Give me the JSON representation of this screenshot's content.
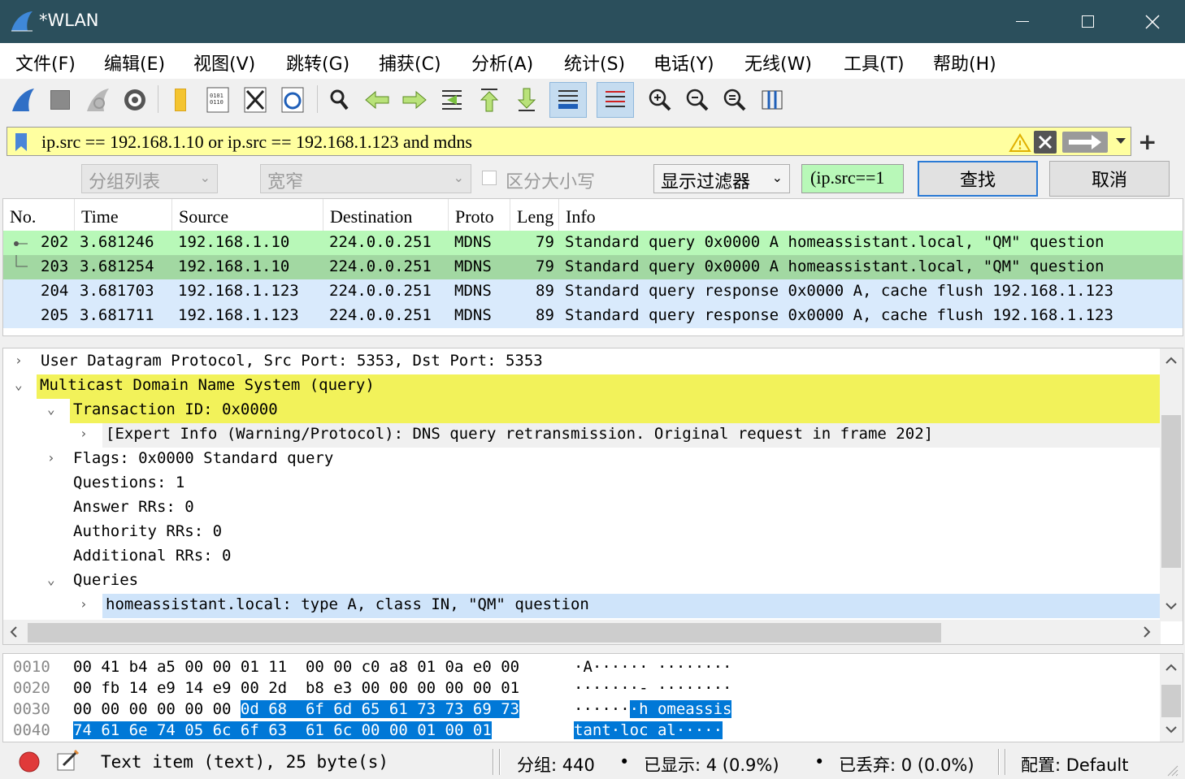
{
  "window": {
    "title": "*WLAN"
  },
  "menu": [
    "文件(F)",
    "编辑(E)",
    "视图(V)",
    "跳转(G)",
    "捕获(C)",
    "分析(A)",
    "统计(S)",
    "电话(Y)",
    "无线(W)",
    "工具(T)",
    "帮助(H)"
  ],
  "toolbar": {
    "icons": [
      "start-capture-icon",
      "stop-capture-icon",
      "restart-capture-icon",
      "capture-options-icon",
      "open-file-icon",
      "save-file-icon",
      "close-file-icon",
      "reload-file-icon",
      "find-packet-icon",
      "go-back-icon",
      "go-forward-icon",
      "go-to-packet-icon",
      "go-first-icon",
      "go-last-icon",
      "autoscroll-icon",
      "colorize-icon",
      "zoom-in-icon",
      "zoom-out-icon",
      "normal-size-icon",
      "resize-columns-icon"
    ]
  },
  "filter": {
    "value": "ip.src == 192.168.1.10 or ip.src == 192.168.1.123 and mdns",
    "warning_color": "#e0b000",
    "bg_color": "#ffffa0"
  },
  "findbar": {
    "scope": "分组列表",
    "charset": "宽窄",
    "case_label": "区分大小写",
    "search_type": "显示过滤器",
    "search_value": "(ip.src==1",
    "find_label": "查找",
    "cancel_label": "取消"
  },
  "packet_list": {
    "columns": [
      "No.",
      "Time",
      "Source",
      "Destination",
      "Proto",
      "Leng",
      "Info"
    ],
    "rows": [
      {
        "no": "202",
        "time": "3.681246",
        "src": "192.168.1.10",
        "dst": "224.0.0.251",
        "proto": "MDNS",
        "len": "79",
        "info": "Standard query 0x0000 A homeassistant.local, \"QM\" question",
        "bg": "#b8f8b8"
      },
      {
        "no": "203",
        "time": "3.681254",
        "src": "192.168.1.10",
        "dst": "224.0.0.251",
        "proto": "MDNS",
        "len": "79",
        "info": "Standard query 0x0000 A homeassistant.local, \"QM\" question",
        "bg": "#a2d8a2"
      },
      {
        "no": "204",
        "time": "3.681703",
        "src": "192.168.1.123",
        "dst": "224.0.0.251",
        "proto": "MDNS",
        "len": "89",
        "info": "Standard query response 0x0000 A, cache flush 192.168.1.123",
        "bg": "#d9eafc"
      },
      {
        "no": "205",
        "time": "3.681711",
        "src": "192.168.1.123",
        "dst": "224.0.0.251",
        "proto": "MDNS",
        "len": "89",
        "info": "Standard query response 0x0000 A, cache flush 192.168.1.123",
        "bg": "#d9eafc"
      }
    ]
  },
  "details": {
    "rows": [
      {
        "text": "User Datagram Protocol, Src Port: 5353, Dst Port: 5353",
        "expander": "›"
      },
      {
        "text": "Multicast Domain Name System (query)",
        "expander": "⌄"
      },
      {
        "text": "Transaction ID: 0x0000",
        "expander": "⌄"
      },
      {
        "text": "[Expert Info (Warning/Protocol): DNS query retransmission. Original request in frame 202]",
        "expander": "›"
      },
      {
        "text": "Flags: 0x0000 Standard query",
        "expander": "›"
      },
      {
        "text": "Questions: 1",
        "expander": ""
      },
      {
        "text": "Answer RRs: 0",
        "expander": ""
      },
      {
        "text": "Authority RRs: 0",
        "expander": ""
      },
      {
        "text": "Additional RRs: 0",
        "expander": ""
      },
      {
        "text": "Queries",
        "expander": "⌄"
      },
      {
        "text": "homeassistant.local: type A, class IN, \"QM\" question",
        "expander": "›"
      }
    ],
    "highlight_yellow": "#f2f25a",
    "highlight_blue": "#cfe4fa"
  },
  "bytes": {
    "rows": [
      {
        "offset": "0010",
        "hex": "00 41 b4 a5 00 00 01 11  00 00 c0 a8 01 0a e0 00",
        "ascii": "·A······ ········"
      },
      {
        "offset": "0020",
        "hex": "00 fb 14 e9 14 e9 00 2d  b8 e3 00 00 00 00 00 01",
        "ascii": "·······- ········"
      },
      {
        "offset": "0030",
        "hex_plain": "00 00 00 00 00 00 ",
        "hex_sel": "0d 68  6f 6d 65 61 73 73 69 73",
        "ascii_plain": "······",
        "ascii_sel": "·h omeassis"
      },
      {
        "offset": "0040",
        "hex_sel": "74 61 6e 74 05 6c 6f 63  61 6c 00 00 01 00 01",
        "ascii_sel": "tant·loc al·····"
      }
    ]
  },
  "status": {
    "field": "Text item (text), 25 byte(s)",
    "packets": "分组: 440",
    "displayed": "已显示: 4 (0.9%)",
    "dropped": "已丢弃: 0 (0.0%)",
    "profile": "配置: Default"
  }
}
